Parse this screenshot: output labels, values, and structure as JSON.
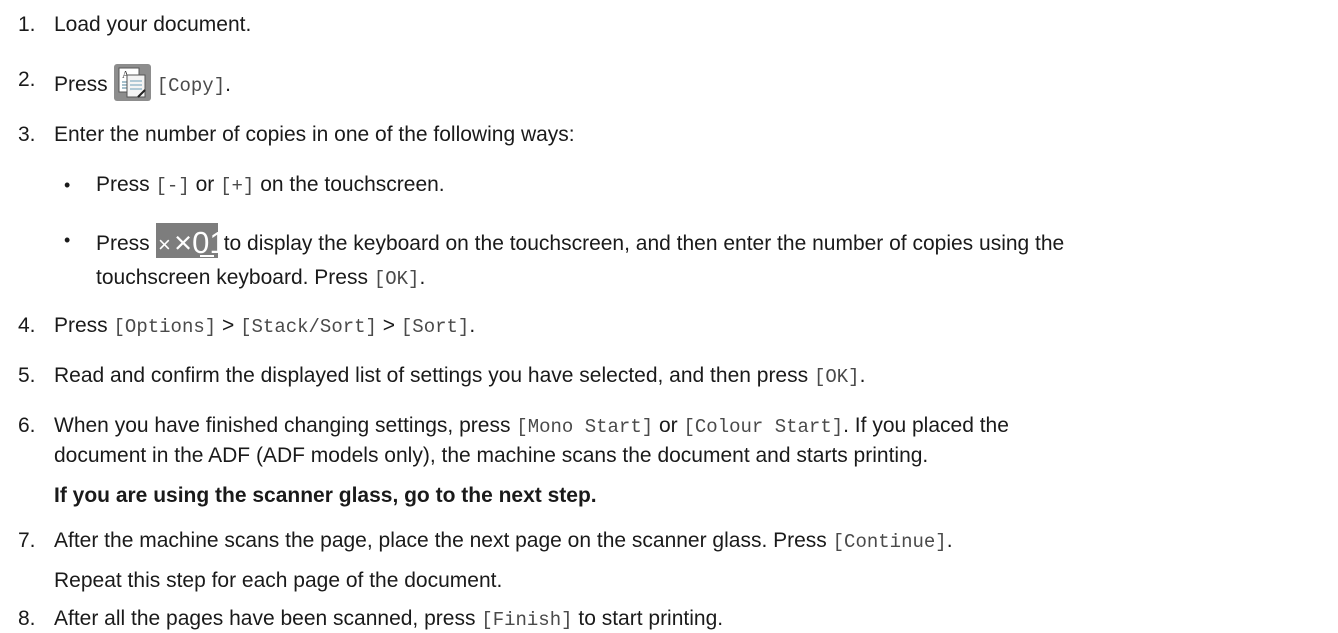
{
  "steps": {
    "s1": {
      "num": "1.",
      "text": "Load your document."
    },
    "s2": {
      "num": "2.",
      "pre": "Press",
      "code": "[Copy]",
      "post": "."
    },
    "s3": {
      "num": "3.",
      "text": "Enter the number of copies in one of the following ways:"
    },
    "b1": {
      "bullet": "•",
      "pre": "Press",
      "code1": "[-]",
      "mid": "or",
      "code2": "[+]",
      "post": "on the touchscreen."
    },
    "b2": {
      "bullet": "•",
      "pre": "Press",
      "icon_label": "×01",
      "post": "to display the keyboard on the touchscreen, and then enter the number of copies using the",
      "line2_pre": "touchscreen keyboard. Press",
      "line2_code": "[OK]",
      "line2_post": "."
    },
    "s4": {
      "num": "4.",
      "pre": "Press",
      "code1": "[Options]",
      "sep1": ">",
      "code2": "[Stack/Sort]",
      "sep2": ">",
      "code3": "[Sort]",
      "post": "."
    },
    "s5": {
      "num": "5.",
      "pre": "Read and confirm the displayed list of settings you have selected, and then press",
      "code": "[OK]",
      "post": "."
    },
    "s6": {
      "num": "6.",
      "pre": "When you have finished changing settings, press",
      "code1": "[Mono Start]",
      "mid": "or",
      "code2": "[Colour Start]",
      "post": ". If you placed the",
      "line2": "document in the ADF (ADF models only), the machine scans the document and starts printing.",
      "note": "If you are using the scanner glass, go to the next step."
    },
    "s7": {
      "num": "7.",
      "pre": "After the machine scans the page, place the next page on the scanner glass. Press",
      "code": "[Continue]",
      "post": ".",
      "line2": "Repeat this step for each page of the document."
    },
    "s8": {
      "num": "8.",
      "pre": "After all the pages have been scanned, press",
      "code": "[Finish]",
      "post": "to start printing."
    }
  },
  "icons": {
    "copy": "copy-document-icon",
    "quantity": "copy-quantity-icon"
  }
}
